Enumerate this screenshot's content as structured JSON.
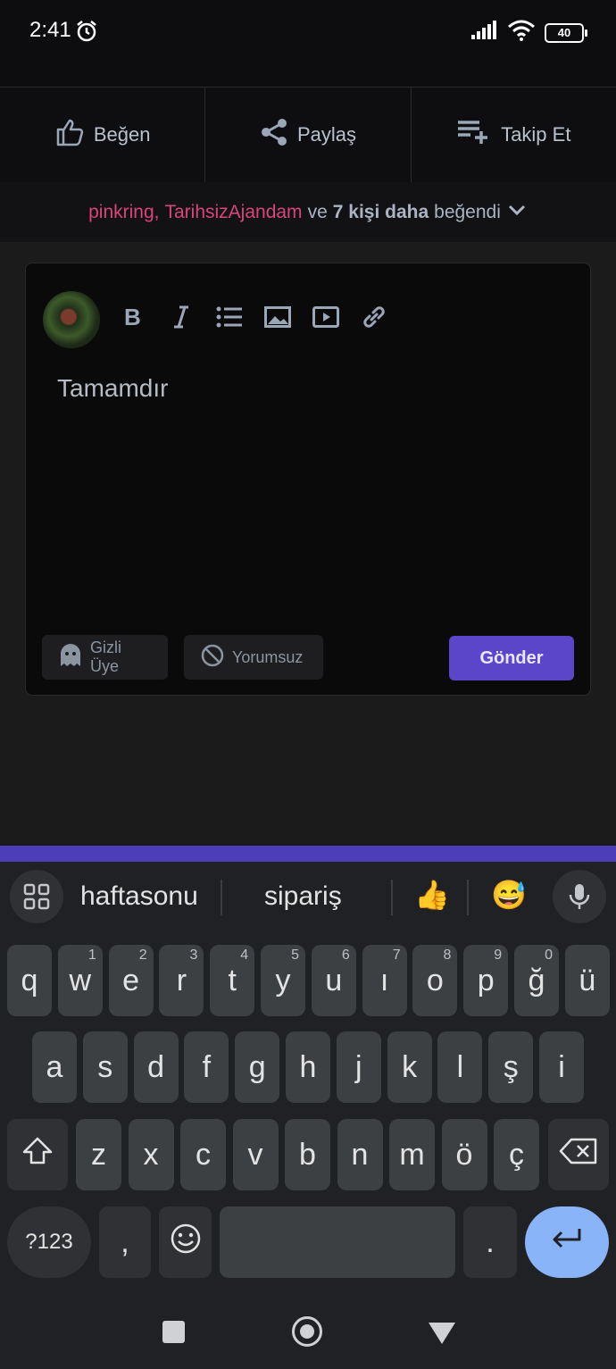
{
  "status_bar": {
    "time": "2:41",
    "battery": "40"
  },
  "actions": {
    "like": "Beğen",
    "share": "Paylaş",
    "follow": "Takip Et"
  },
  "likes_line": {
    "user1": "pinkring,",
    "user2": "TarihsizAjandam",
    "and": "ve",
    "count": "7 kişi daha",
    "suffix": "beğendi"
  },
  "editor": {
    "text": "Tamamdır",
    "anon_label": "Gizli Üye",
    "no_comment_label": "Yorumsuz",
    "send_label": "Gönder"
  },
  "keyboard": {
    "suggestions": [
      "haftasonu",
      "sipariş"
    ],
    "emoji_suggestions": [
      "👍",
      "😅"
    ],
    "row1": [
      {
        "k": "q",
        "s": ""
      },
      {
        "k": "w",
        "s": "1"
      },
      {
        "k": "e",
        "s": "2"
      },
      {
        "k": "r",
        "s": "3"
      },
      {
        "k": "t",
        "s": "4"
      },
      {
        "k": "y",
        "s": "5"
      },
      {
        "k": "u",
        "s": "6"
      },
      {
        "k": "ı",
        "s": "7"
      },
      {
        "k": "o",
        "s": "8"
      },
      {
        "k": "p",
        "s": "9"
      },
      {
        "k": "ğ",
        "s": "0"
      },
      {
        "k": "ü",
        "s": ""
      }
    ],
    "row2": [
      "a",
      "s",
      "d",
      "f",
      "g",
      "h",
      "j",
      "k",
      "l",
      "ş",
      "i"
    ],
    "row3": [
      "z",
      "x",
      "c",
      "v",
      "b",
      "n",
      "m",
      "ö",
      "ç"
    ],
    "symbols_label": "?123",
    "comma": ",",
    "period": "."
  }
}
